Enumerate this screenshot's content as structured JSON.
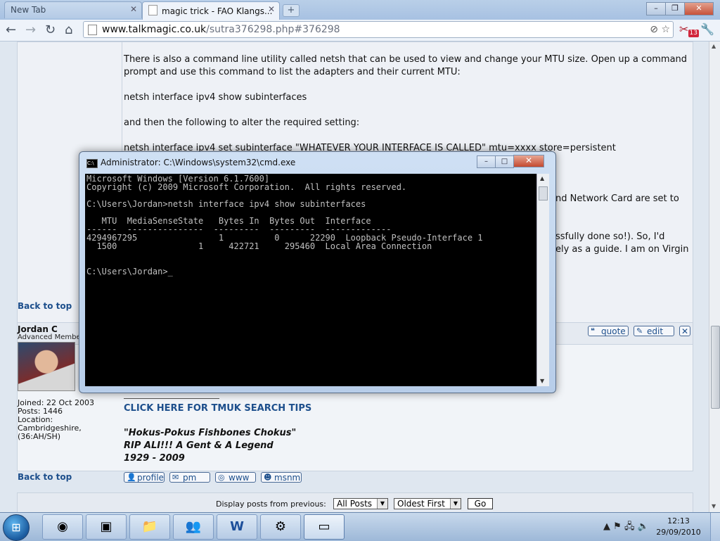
{
  "browser": {
    "tabs": [
      {
        "label": "New Tab"
      },
      {
        "label": "magic trick - FAO Klangs..."
      }
    ],
    "url_host": "www.talkmagic.co.uk",
    "url_path": "/sutra376298.php#376298",
    "badge_count": "13"
  },
  "post1": {
    "paragraph1_line1": "There is also a command line utility called netsh that can be used to view and change your MTU size. Open up a command",
    "paragraph1_line2": "prompt and use this command to list the adapters and their current MTU:",
    "command1": "netsh interface ipv4 show subinterfaces",
    "paragraph2": "and then the following to alter the required setting:",
    "command2": "netsh interface ipv4 set subinterface \"WHATEVER YOUR INTERFACE IS CALLED\" mtu=xxxx store=persistent",
    "fragment1": "nd Network Card are set to",
    "fragment2": "ssfully done so!). So, I'd",
    "fragment3": "ely as a guide. I am on Virgin",
    "back_to_top": "Back to top"
  },
  "post2": {
    "username": "Jordan C",
    "rank": "Advanced Member",
    "joined": "Joined: 22 Oct 2003",
    "posts": "Posts: 1446",
    "location_label": "Location:",
    "location_value": "Cambridgeshire,",
    "location_extra": "(36:AH/SH)",
    "quote_label": "quote",
    "edit_label": "edit",
    "search_tips": "CLICK HERE FOR TMUK SEARCH TIPS",
    "sig_line1": "\"Hokus-Pokus Fishbones Chokus\"",
    "sig_line2": "RIP ALI!!! A Gent & A Legend",
    "sig_line3": "1929 - 2009",
    "back_to_top": "Back to top",
    "buttons": {
      "profile": "profile",
      "pm": "pm",
      "www": "www",
      "msnm": "msnm"
    }
  },
  "footer": {
    "display_label": "Display posts from previous:",
    "select_period": "All Posts",
    "select_order": "Oldest First",
    "go_label": "Go"
  },
  "cmd": {
    "title": "Administrator: C:\\Windows\\system32\\cmd.exe",
    "lines": [
      "Microsoft Windows [Version 6.1.7600]",
      "Copyright (c) 2009 Microsoft Corporation.  All rights reserved.",
      "",
      "C:\\Users\\Jordan>netsh interface ipv4 show subinterfaces",
      "",
      "   MTU  MediaSenseState   Bytes In  Bytes Out  Interface",
      "------  ---------------  ---------  ---------  -------------",
      "4294967295                1          0      22290  Loopback Pseudo-Interface 1",
      "  1500                1     422721     295460  Local Area Connection",
      "",
      "",
      "C:\\Users\\Jordan>_"
    ]
  },
  "taskbar": {
    "time": "12:13",
    "date": "29/09/2010"
  }
}
